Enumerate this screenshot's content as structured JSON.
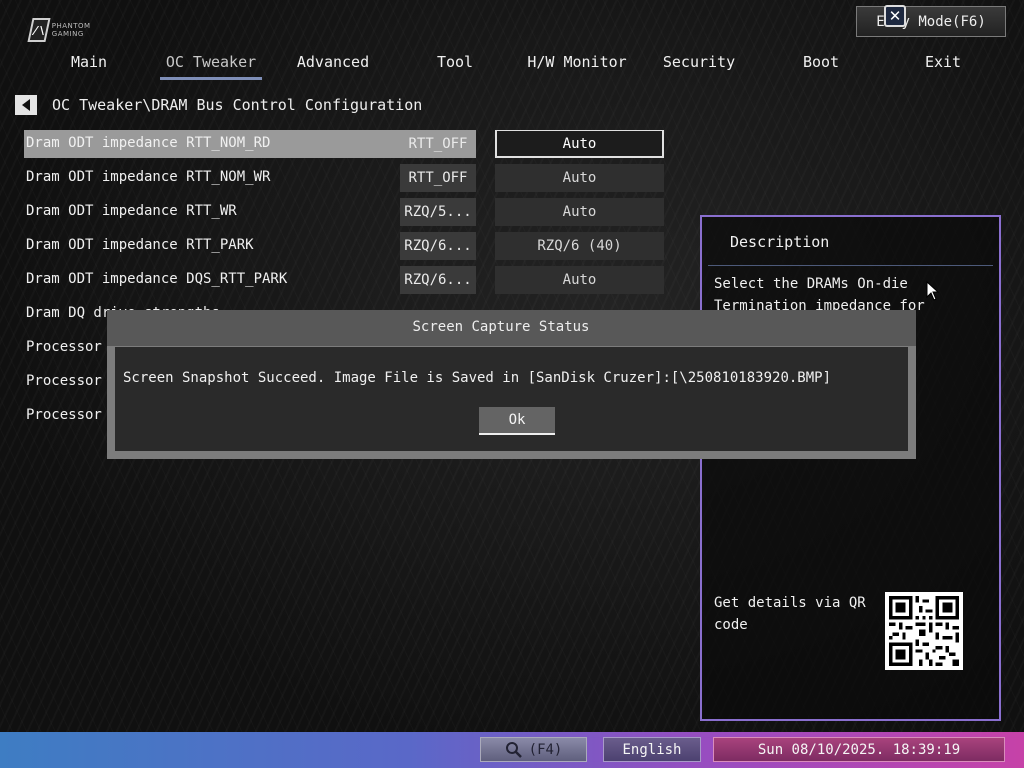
{
  "header": {
    "logo_text": "PHANTOM GAMING",
    "easy_mode_label": "Easy Mode(F6)"
  },
  "nav": {
    "tabs": [
      {
        "label": "Main"
      },
      {
        "label": "OC Tweaker",
        "active": true
      },
      {
        "label": "Advanced"
      },
      {
        "label": "Tool"
      },
      {
        "label": "H/W Monitor"
      },
      {
        "label": "Security"
      },
      {
        "label": "Boot"
      },
      {
        "label": "Exit"
      }
    ]
  },
  "breadcrumb": "OC Tweaker\\DRAM Bus Control Configuration",
  "settings": [
    {
      "label": "Dram ODT impedance RTT_NOM_RD",
      "current": "RTT_OFF",
      "selected_value": "Auto",
      "selected": true
    },
    {
      "label": "Dram ODT impedance RTT_NOM_WR",
      "current": "RTT_OFF",
      "selected_value": "Auto"
    },
    {
      "label": "Dram ODT impedance RTT_WR",
      "current": "RZQ/5...",
      "selected_value": "Auto"
    },
    {
      "label": "Dram ODT impedance RTT_PARK",
      "current": "RZQ/6...",
      "selected_value": "RZQ/6 (40)"
    },
    {
      "label": "Dram ODT impedance DQS_RTT_PARK",
      "current": "RZQ/6...",
      "selected_value": "Auto"
    },
    {
      "label": "Dram DQ drive strengths",
      "current": "",
      "selected_value": ""
    },
    {
      "label": "Processor",
      "current": "",
      "selected_value": ""
    },
    {
      "label": "Processor",
      "current": "",
      "selected_value": ""
    },
    {
      "label": "Processor",
      "current": "",
      "selected_value": ""
    }
  ],
  "description": {
    "title": "Description",
    "text": "Select the DRAMs On-die Termination impedance for RTT_NOM_RD",
    "qr_label": "Get details via QR code"
  },
  "dialog": {
    "title": "Screen Capture Status",
    "message": "Screen Snapshot Succeed. Image File is Saved in  [SanDisk Cruzer]:[\\250810183920.BMP]",
    "ok_label": "Ok"
  },
  "footer": {
    "search_label": "(F4)",
    "language": "English",
    "datetime": "Sun 08/10/2025. 18:39:19"
  },
  "colors": {
    "panel_border": "#8a6fcf",
    "nav_active_underline": "#7f8fb8",
    "bottom_bar_start": "#3e7dc3",
    "bottom_bar_end": "#c642a8"
  }
}
